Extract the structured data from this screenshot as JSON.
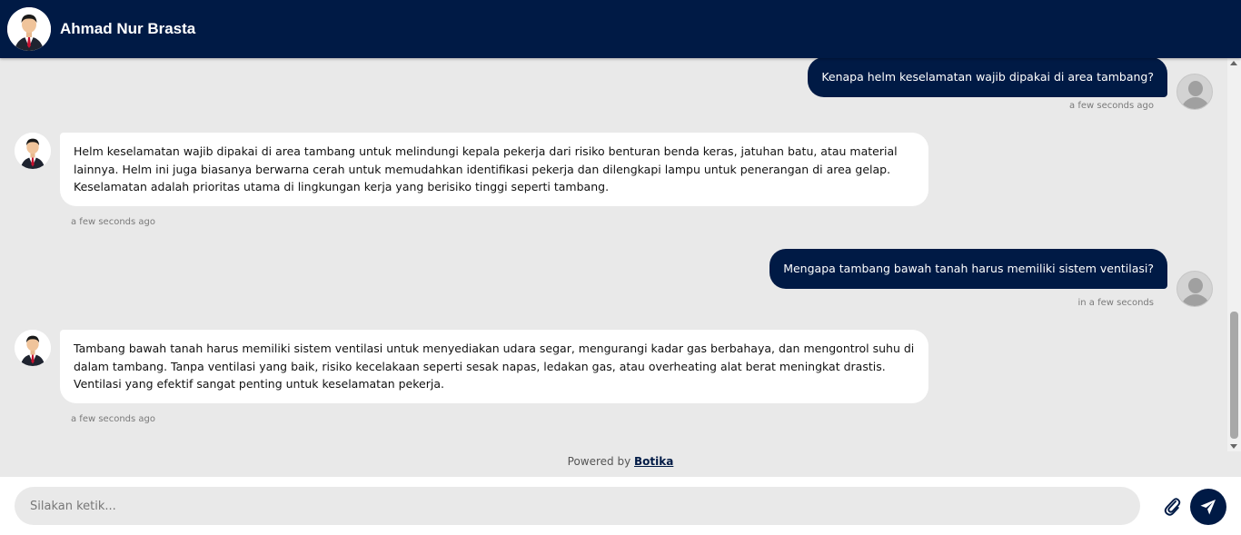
{
  "header": {
    "title": "Ahmad Nur Brasta",
    "avatar_icon": "person-suit-avatar-icon"
  },
  "messages": [
    {
      "from": "user",
      "text": "Kenapa helm keselamatan wajib dipakai di area tambang?",
      "time": "a few seconds ago"
    },
    {
      "from": "bot",
      "text": "Helm keselamatan wajib dipakai di area tambang untuk melindungi kepala pekerja dari risiko benturan benda keras, jatuhan batu, atau material lainnya. Helm ini juga biasanya berwarna cerah untuk memudahkan identifikasi pekerja dan dilengkapi lampu untuk penerangan di area gelap. Keselamatan adalah prioritas utama di lingkungan kerja yang berisiko tinggi seperti tambang.",
      "time": "a few seconds ago"
    },
    {
      "from": "user",
      "text": "Mengapa tambang bawah tanah harus memiliki sistem ventilasi?",
      "time": "in a few seconds"
    },
    {
      "from": "bot",
      "text": "Tambang bawah tanah harus memiliki sistem ventilasi untuk menyediakan udara segar, mengurangi kadar gas berbahaya, dan mengontrol suhu di dalam tambang. Tanpa ventilasi yang baik, risiko kecelakaan seperti sesak napas, ledakan gas, atau overheating alat berat meningkat drastis. Ventilasi yang efektif sangat penting untuk keselamatan pekerja.",
      "time": "a few seconds ago"
    }
  ],
  "powered_by": {
    "prefix": "Powered by",
    "link": "Botika"
  },
  "composer": {
    "placeholder": "Silakan ketik...",
    "attach_icon": "paperclip-icon",
    "send_icon": "paper-plane-icon"
  },
  "colors": {
    "primary": "#001a45",
    "chat_background": "#e9e9e9",
    "bubble_bot": "#ffffff"
  }
}
